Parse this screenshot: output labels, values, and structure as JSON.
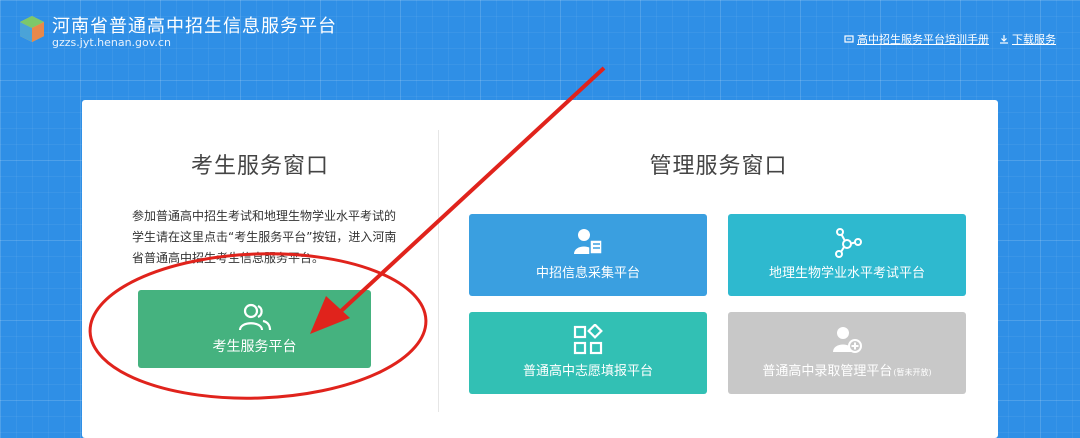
{
  "header": {
    "title": "河南省普通高中招生信息服务平台",
    "domain": "gzzs.jyt.henan.gov.cn",
    "links": [
      {
        "label": "高中招生服务平台培训手册",
        "icon": "manual-icon"
      },
      {
        "label": "下载服务",
        "icon": "download-icon"
      }
    ]
  },
  "student_panel": {
    "title": "考生服务窗口",
    "description": "参加普通高中招生考试和地理生物学业水平考试的学生请在这里点击“考生服务平台”按钮，进入河南省普通高中招生考生信息服务平台。",
    "button_label": "考生服务平台",
    "button_icon": "users-icon",
    "button_color": "#45b27f"
  },
  "admin_panel": {
    "title": "管理服务窗口",
    "tiles": [
      {
        "label": "中招信息采集平台",
        "icon": "user-card-icon",
        "color": "#3a9fe0"
      },
      {
        "label": "地理生物学业水平考试平台",
        "icon": "network-icon",
        "color": "#2eb9cf"
      },
      {
        "label": "普通高中志愿填报平台",
        "icon": "grid-icon",
        "color": "#32c0b4"
      },
      {
        "label": "普通高中录取管理平台",
        "note": "(暂未开放)",
        "icon": "user-add-icon",
        "color": "#c8c8c8"
      }
    ]
  },
  "annotation": {
    "color": "#e0231c"
  }
}
